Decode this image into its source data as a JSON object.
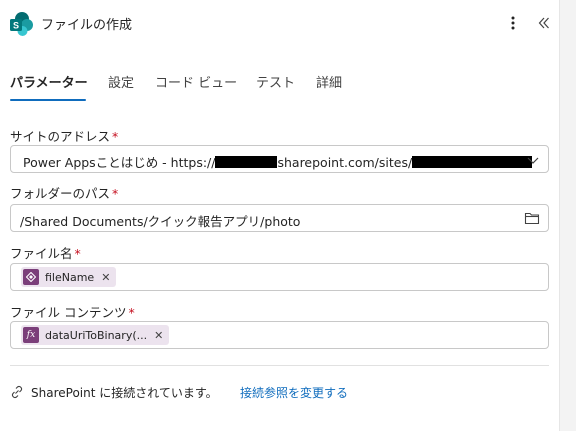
{
  "header": {
    "title": "ファイルの作成",
    "app_icon": "sharepoint-icon",
    "more_icon": "more-vertical-icon",
    "collapse_icon": "double-chevron-left-icon"
  },
  "tabs": [
    {
      "label": "パラメーター",
      "active": true
    },
    {
      "label": "設定",
      "active": false
    },
    {
      "label": "コード ビュー",
      "active": false
    },
    {
      "label": "テスト",
      "active": false
    },
    {
      "label": "詳細",
      "active": false
    }
  ],
  "fields": {
    "site": {
      "label": "サイトのアドレス",
      "required_mark": "*",
      "value_prefix": "Power Appsことはじめ - https://",
      "value_middle": "sharepoint.com/sites/"
    },
    "folder": {
      "label": "フォルダーのパス",
      "required_mark": "*",
      "value": "/Shared Documents/クイック報告アプリ/photo"
    },
    "filename": {
      "label": "ファイル名",
      "required_mark": "*",
      "token_label": "fileName",
      "token_icon": "power-apps-token-icon"
    },
    "content": {
      "label": "ファイル コンテンツ",
      "required_mark": "*",
      "token_label": "dataUriToBinary(...",
      "token_icon": "fx-expression-icon",
      "token_icon_text": "fx"
    }
  },
  "connection": {
    "status_text": "SharePoint に接続されています。",
    "change_link": "接続参照を変更する"
  },
  "colors": {
    "accent": "#0f6cbd",
    "required": "#c50f1f",
    "token_bg": "#ece3ee",
    "token_icon": "#7b3f7a"
  }
}
